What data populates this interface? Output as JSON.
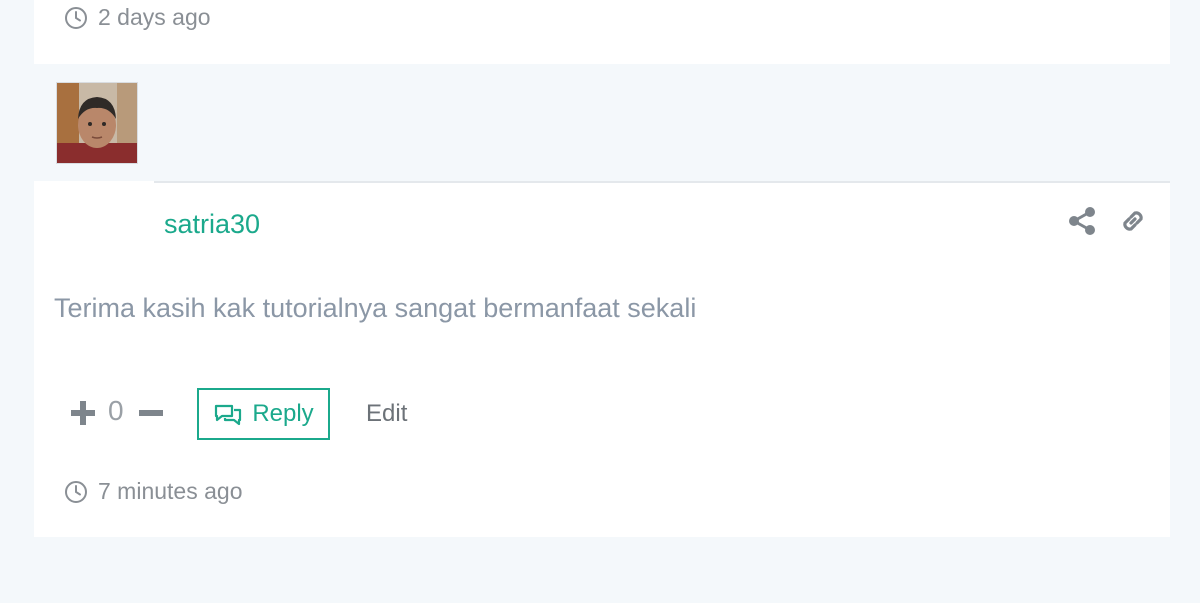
{
  "previous_comment": {
    "timestamp": "2 days ago"
  },
  "comment": {
    "author": "satria30",
    "text": "Terima kasih kak tutorialnya sangat bermanfaat sekali",
    "votes": "0",
    "reply_label": "Reply",
    "edit_label": "Edit",
    "timestamp": "7 minutes ago",
    "icons": {
      "share": "share-icon",
      "link": "link-icon",
      "plus": "plus-icon",
      "minus": "minus-icon",
      "reply": "chat-bubbles-icon",
      "time": "clock-icon"
    }
  },
  "colors": {
    "accent": "#1ba98c",
    "page_background": "#f4f8fb",
    "card_background": "#ffffff",
    "comment_text": "#8b97a6",
    "muted_text": "#8a8f95"
  }
}
